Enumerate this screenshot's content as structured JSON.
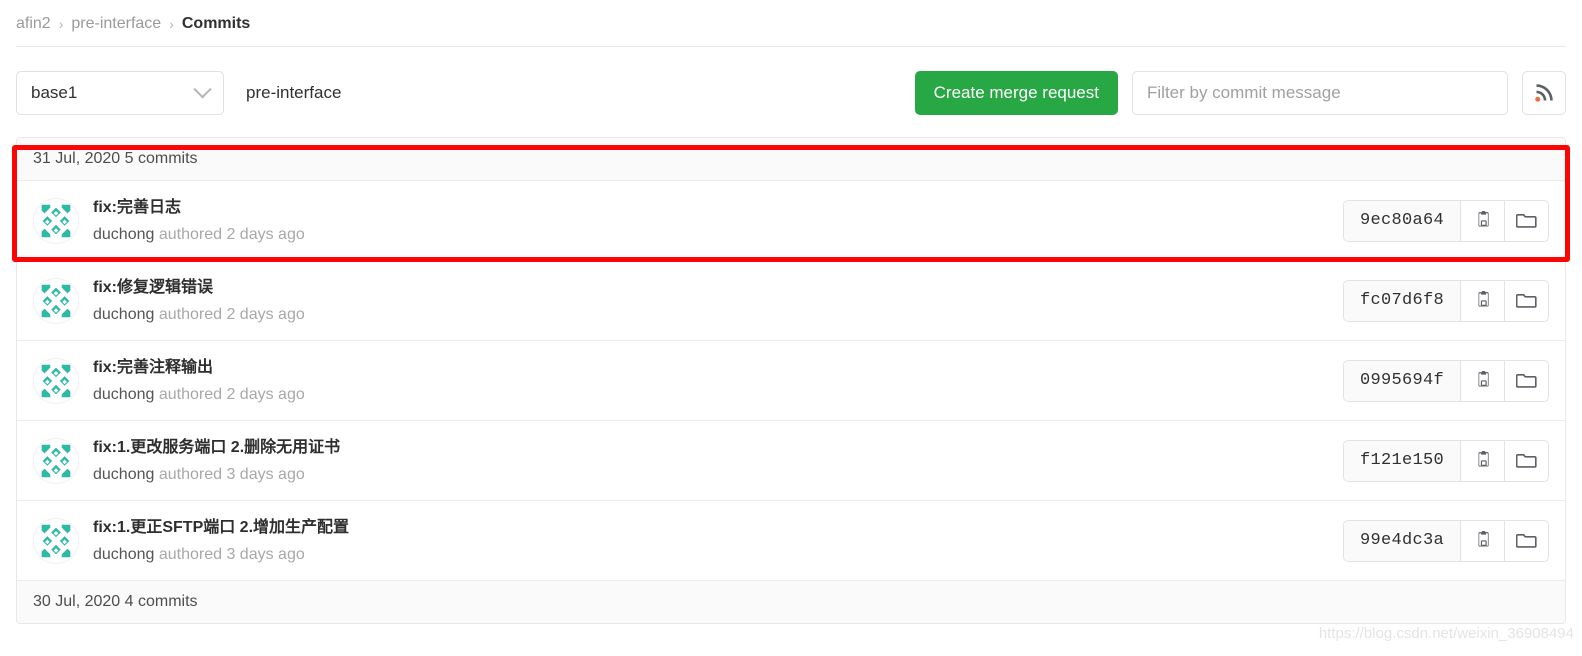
{
  "breadcrumb": {
    "namespace": "afin2",
    "separator": "›",
    "project": "pre-interface",
    "current": "Commits"
  },
  "toolbar": {
    "branch_selected": "base1",
    "ref_label": "pre-interface",
    "create_mr_label": "Create merge request",
    "filter_placeholder": "Filter by commit message",
    "filter_value": "",
    "feed_icon": "rss-icon",
    "chevron_icon": "chevron-down-icon",
    "accent_green": "#28a745"
  },
  "commit_groups": [
    {
      "date_label": "31 Jul, 2020 5 commits",
      "commits": [
        {
          "title": "fix:完善日志",
          "author": "duchong",
          "authored_text": "authored 2 days ago",
          "sha": "9ec80a64",
          "copy_icon": "clipboard-icon",
          "browse_icon": "folder-icon"
        },
        {
          "title": "fix:修复逻辑错误",
          "author": "duchong",
          "authored_text": "authored 2 days ago",
          "sha": "fc07d6f8",
          "copy_icon": "clipboard-icon",
          "browse_icon": "folder-icon"
        },
        {
          "title": "fix:完善注释输出",
          "author": "duchong",
          "authored_text": "authored 2 days ago",
          "sha": "0995694f",
          "copy_icon": "clipboard-icon",
          "browse_icon": "folder-icon"
        },
        {
          "title": "fix:1.更改服务端口 2.删除无用证书",
          "author": "duchong",
          "authored_text": "authored 3 days ago",
          "sha": "f121e150",
          "copy_icon": "clipboard-icon",
          "browse_icon": "folder-icon"
        },
        {
          "title": "fix:1.更正SFTP端口 2.增加生产配置",
          "author": "duchong",
          "authored_text": "authored 3 days ago",
          "sha": "99e4dc3a",
          "copy_icon": "clipboard-icon",
          "browse_icon": "folder-icon"
        }
      ]
    },
    {
      "date_label": "30 Jul, 2020 4 commits",
      "commits": []
    }
  ],
  "annotation": {
    "highlight_color": "#fb0505"
  },
  "watermark": {
    "text": "https://blog.csdn.net/weixin_36908494"
  }
}
